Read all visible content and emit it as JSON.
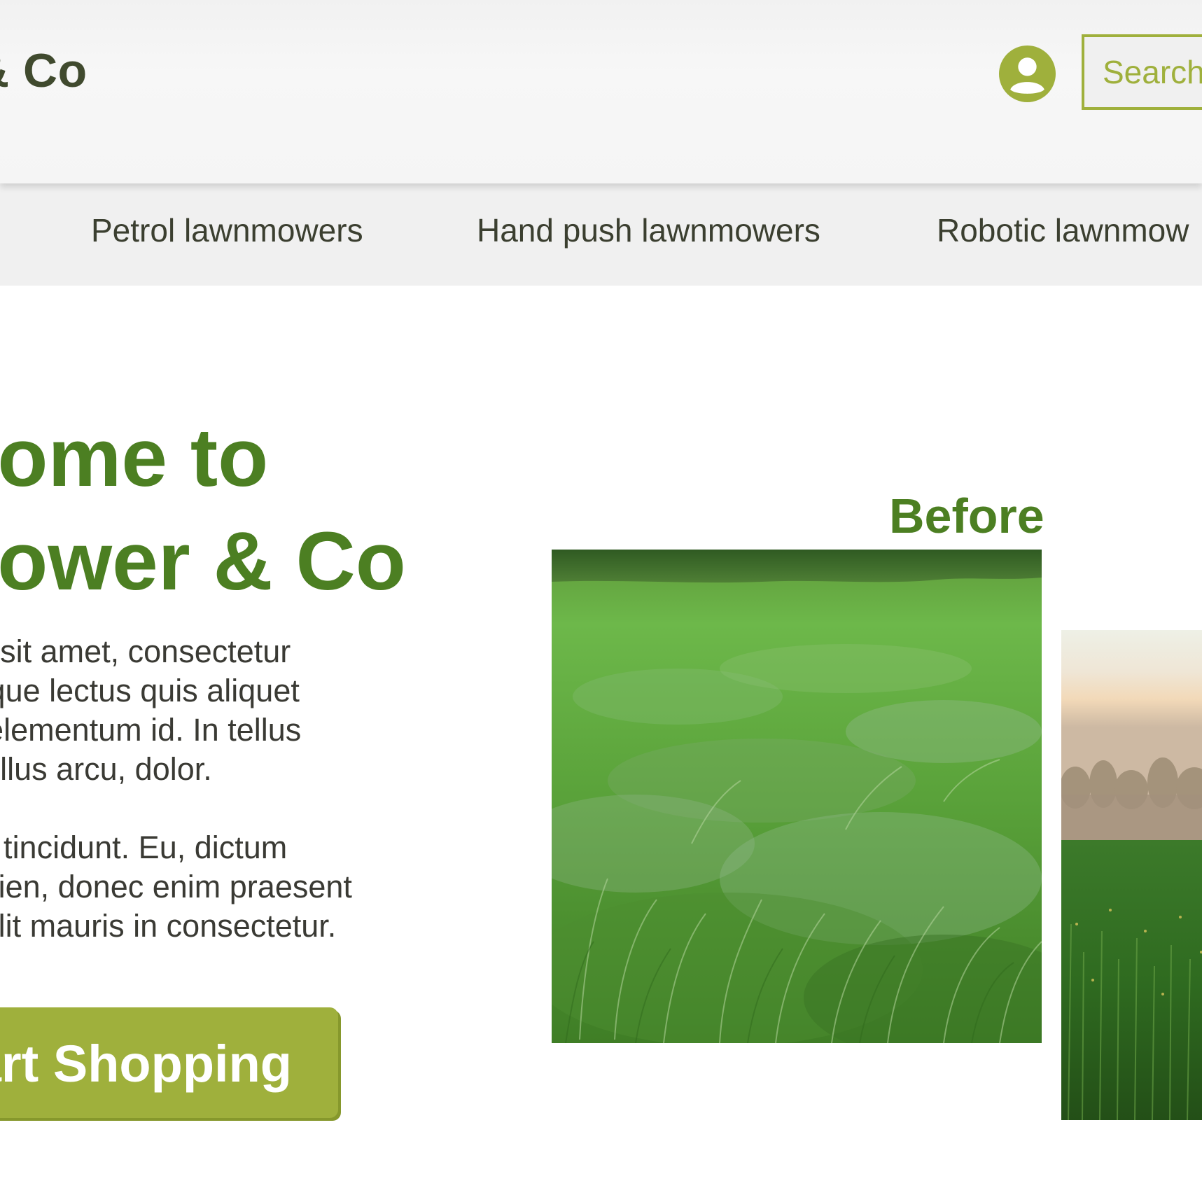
{
  "header": {
    "brand": "& Co",
    "search_placeholder": "Search"
  },
  "nav": {
    "items": [
      {
        "label": "Petrol lawnmowers"
      },
      {
        "label": "Hand push lawnmowers"
      },
      {
        "label": "Robotic lawnmow"
      }
    ]
  },
  "hero": {
    "title_line1": "lcome to",
    "title_line2": "Mower & Co",
    "paragraph1_lines": [
      "n dolor sit amet, consectetur",
      "t. Natoque lectus quis aliquet",
      "et nisl elementum id. In tellus",
      "r phasellus arcu, dolor."
    ],
    "paragraph2_lines": [
      " id et sit tincidunt. Eu, dictum",
      "am sapien, donec enim praesent",
      "s non elit mauris in consectetur."
    ],
    "cta_label": "Start Shopping"
  },
  "gallery": {
    "before_label": "Before"
  },
  "colors": {
    "brand_dark": "#404a2e",
    "accent_green": "#4c7f22",
    "olive": "#9fb03c"
  },
  "icons": {
    "account": "user-circle-icon"
  }
}
